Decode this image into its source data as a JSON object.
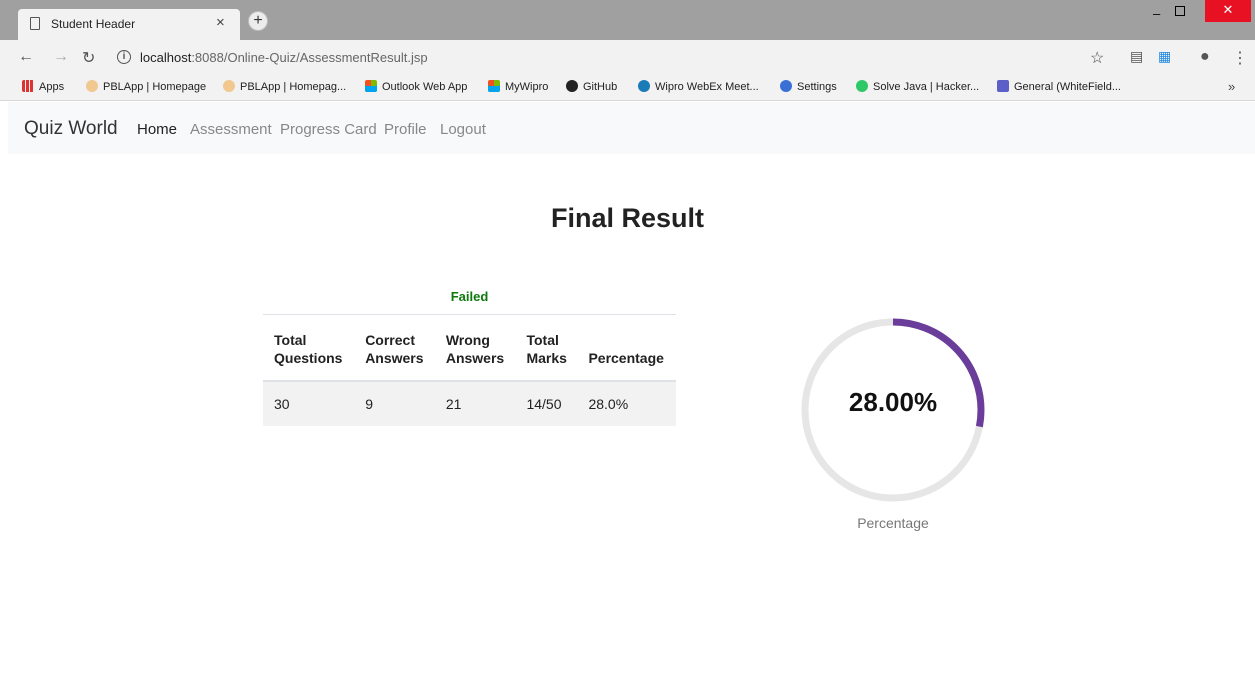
{
  "browser": {
    "tab_title": "Student Header",
    "url_host": "localhost",
    "url_path": ":8088/Online-Quiz/AssessmentResult.jsp",
    "bookmarks": [
      {
        "label": "Apps",
        "icon": "apps-grid-icon"
      },
      {
        "label": "PBLApp | Homepage",
        "icon": "pblapp-icon"
      },
      {
        "label": "PBLApp | Homepag...",
        "icon": "pblapp-icon"
      },
      {
        "label": "Outlook Web App",
        "icon": "microsoft-icon"
      },
      {
        "label": "MyWipro",
        "icon": "microsoft-icon"
      },
      {
        "label": "GitHub",
        "icon": "github-icon"
      },
      {
        "label": "Wipro WebEx Meet...",
        "icon": "webex-icon"
      },
      {
        "label": "Settings",
        "icon": "settings-gear-icon"
      },
      {
        "label": "Solve Java | Hacker...",
        "icon": "hackerrank-icon"
      },
      {
        "label": "General (WhiteField...",
        "icon": "teams-icon"
      }
    ]
  },
  "navbar": {
    "brand": "Quiz World",
    "links": [
      "Home",
      "Assessment",
      "Progress Card",
      "Profile",
      "Logout"
    ]
  },
  "page": {
    "title": "Final Result"
  },
  "result_table": {
    "status": "Failed",
    "headers": {
      "total_questions": [
        "Total",
        "Questions"
      ],
      "correct_answers": [
        "Correct",
        "Answers"
      ],
      "wrong_answers": [
        "Wrong",
        "Answers"
      ],
      "total_marks": [
        "Total",
        "Marks"
      ],
      "percentage": "Percentage"
    },
    "row": {
      "total_questions": "30",
      "correct_answers": "9",
      "wrong_answers": "21",
      "total_marks": "14/50",
      "percentage": "28.0%"
    }
  },
  "gauge": {
    "value_text": "28.00%",
    "value_fraction": 0.28,
    "label": "Percentage",
    "colors": {
      "track": "#e6e6e6",
      "fill": "#6a3d9a"
    }
  },
  "colors": {
    "status_failed": "#0b7a0b"
  }
}
